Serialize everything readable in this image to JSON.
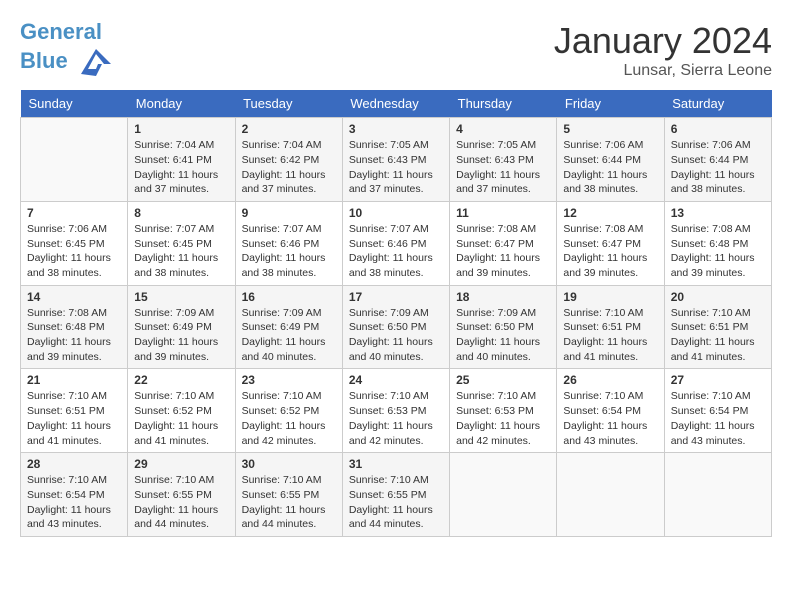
{
  "header": {
    "logo_line1": "General",
    "logo_line2": "Blue",
    "month": "January 2024",
    "location": "Lunsar, Sierra Leone"
  },
  "weekdays": [
    "Sunday",
    "Monday",
    "Tuesday",
    "Wednesday",
    "Thursday",
    "Friday",
    "Saturday"
  ],
  "weeks": [
    [
      {
        "day": "",
        "sunrise": "",
        "sunset": "",
        "daylight": ""
      },
      {
        "day": "1",
        "sunrise": "Sunrise: 7:04 AM",
        "sunset": "Sunset: 6:41 PM",
        "daylight": "Daylight: 11 hours and 37 minutes."
      },
      {
        "day": "2",
        "sunrise": "Sunrise: 7:04 AM",
        "sunset": "Sunset: 6:42 PM",
        "daylight": "Daylight: 11 hours and 37 minutes."
      },
      {
        "day": "3",
        "sunrise": "Sunrise: 7:05 AM",
        "sunset": "Sunset: 6:43 PM",
        "daylight": "Daylight: 11 hours and 37 minutes."
      },
      {
        "day": "4",
        "sunrise": "Sunrise: 7:05 AM",
        "sunset": "Sunset: 6:43 PM",
        "daylight": "Daylight: 11 hours and 37 minutes."
      },
      {
        "day": "5",
        "sunrise": "Sunrise: 7:06 AM",
        "sunset": "Sunset: 6:44 PM",
        "daylight": "Daylight: 11 hours and 38 minutes."
      },
      {
        "day": "6",
        "sunrise": "Sunrise: 7:06 AM",
        "sunset": "Sunset: 6:44 PM",
        "daylight": "Daylight: 11 hours and 38 minutes."
      }
    ],
    [
      {
        "day": "7",
        "sunrise": "Sunrise: 7:06 AM",
        "sunset": "Sunset: 6:45 PM",
        "daylight": "Daylight: 11 hours and 38 minutes."
      },
      {
        "day": "8",
        "sunrise": "Sunrise: 7:07 AM",
        "sunset": "Sunset: 6:45 PM",
        "daylight": "Daylight: 11 hours and 38 minutes."
      },
      {
        "day": "9",
        "sunrise": "Sunrise: 7:07 AM",
        "sunset": "Sunset: 6:46 PM",
        "daylight": "Daylight: 11 hours and 38 minutes."
      },
      {
        "day": "10",
        "sunrise": "Sunrise: 7:07 AM",
        "sunset": "Sunset: 6:46 PM",
        "daylight": "Daylight: 11 hours and 38 minutes."
      },
      {
        "day": "11",
        "sunrise": "Sunrise: 7:08 AM",
        "sunset": "Sunset: 6:47 PM",
        "daylight": "Daylight: 11 hours and 39 minutes."
      },
      {
        "day": "12",
        "sunrise": "Sunrise: 7:08 AM",
        "sunset": "Sunset: 6:47 PM",
        "daylight": "Daylight: 11 hours and 39 minutes."
      },
      {
        "day": "13",
        "sunrise": "Sunrise: 7:08 AM",
        "sunset": "Sunset: 6:48 PM",
        "daylight": "Daylight: 11 hours and 39 minutes."
      }
    ],
    [
      {
        "day": "14",
        "sunrise": "Sunrise: 7:08 AM",
        "sunset": "Sunset: 6:48 PM",
        "daylight": "Daylight: 11 hours and 39 minutes."
      },
      {
        "day": "15",
        "sunrise": "Sunrise: 7:09 AM",
        "sunset": "Sunset: 6:49 PM",
        "daylight": "Daylight: 11 hours and 39 minutes."
      },
      {
        "day": "16",
        "sunrise": "Sunrise: 7:09 AM",
        "sunset": "Sunset: 6:49 PM",
        "daylight": "Daylight: 11 hours and 40 minutes."
      },
      {
        "day": "17",
        "sunrise": "Sunrise: 7:09 AM",
        "sunset": "Sunset: 6:50 PM",
        "daylight": "Daylight: 11 hours and 40 minutes."
      },
      {
        "day": "18",
        "sunrise": "Sunrise: 7:09 AM",
        "sunset": "Sunset: 6:50 PM",
        "daylight": "Daylight: 11 hours and 40 minutes."
      },
      {
        "day": "19",
        "sunrise": "Sunrise: 7:10 AM",
        "sunset": "Sunset: 6:51 PM",
        "daylight": "Daylight: 11 hours and 41 minutes."
      },
      {
        "day": "20",
        "sunrise": "Sunrise: 7:10 AM",
        "sunset": "Sunset: 6:51 PM",
        "daylight": "Daylight: 11 hours and 41 minutes."
      }
    ],
    [
      {
        "day": "21",
        "sunrise": "Sunrise: 7:10 AM",
        "sunset": "Sunset: 6:51 PM",
        "daylight": "Daylight: 11 hours and 41 minutes."
      },
      {
        "day": "22",
        "sunrise": "Sunrise: 7:10 AM",
        "sunset": "Sunset: 6:52 PM",
        "daylight": "Daylight: 11 hours and 41 minutes."
      },
      {
        "day": "23",
        "sunrise": "Sunrise: 7:10 AM",
        "sunset": "Sunset: 6:52 PM",
        "daylight": "Daylight: 11 hours and 42 minutes."
      },
      {
        "day": "24",
        "sunrise": "Sunrise: 7:10 AM",
        "sunset": "Sunset: 6:53 PM",
        "daylight": "Daylight: 11 hours and 42 minutes."
      },
      {
        "day": "25",
        "sunrise": "Sunrise: 7:10 AM",
        "sunset": "Sunset: 6:53 PM",
        "daylight": "Daylight: 11 hours and 42 minutes."
      },
      {
        "day": "26",
        "sunrise": "Sunrise: 7:10 AM",
        "sunset": "Sunset: 6:54 PM",
        "daylight": "Daylight: 11 hours and 43 minutes."
      },
      {
        "day": "27",
        "sunrise": "Sunrise: 7:10 AM",
        "sunset": "Sunset: 6:54 PM",
        "daylight": "Daylight: 11 hours and 43 minutes."
      }
    ],
    [
      {
        "day": "28",
        "sunrise": "Sunrise: 7:10 AM",
        "sunset": "Sunset: 6:54 PM",
        "daylight": "Daylight: 11 hours and 43 minutes."
      },
      {
        "day": "29",
        "sunrise": "Sunrise: 7:10 AM",
        "sunset": "Sunset: 6:55 PM",
        "daylight": "Daylight: 11 hours and 44 minutes."
      },
      {
        "day": "30",
        "sunrise": "Sunrise: 7:10 AM",
        "sunset": "Sunset: 6:55 PM",
        "daylight": "Daylight: 11 hours and 44 minutes."
      },
      {
        "day": "31",
        "sunrise": "Sunrise: 7:10 AM",
        "sunset": "Sunset: 6:55 PM",
        "daylight": "Daylight: 11 hours and 44 minutes."
      },
      {
        "day": "",
        "sunrise": "",
        "sunset": "",
        "daylight": ""
      },
      {
        "day": "",
        "sunrise": "",
        "sunset": "",
        "daylight": ""
      },
      {
        "day": "",
        "sunrise": "",
        "sunset": "",
        "daylight": ""
      }
    ]
  ]
}
